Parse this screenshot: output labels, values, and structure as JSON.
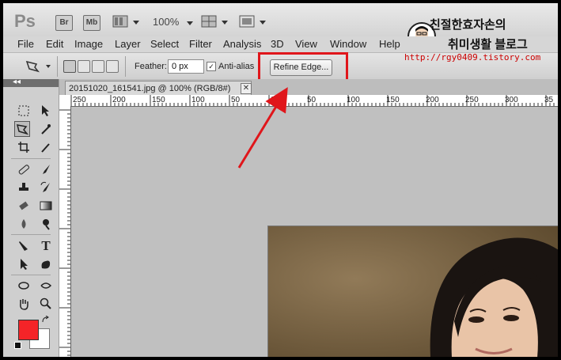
{
  "appbar": {
    "app_logo": "Ps",
    "bridge_label": "Br",
    "minibridge_label": "Mb",
    "zoom": "100%"
  },
  "menu": {
    "items": [
      "File",
      "Edit",
      "Image",
      "Layer",
      "Select",
      "Filter",
      "Analysis",
      "3D",
      "View",
      "Window",
      "Help"
    ]
  },
  "options": {
    "feather_label": "Feather:",
    "feather_value": "0 px",
    "antialias_label": "Anti-alias",
    "antialias_checked": "✓",
    "refine_edge_label": "Refine Edge..."
  },
  "toolbar": {
    "collapse_label": "◂◂",
    "foreground_color": "#f42428",
    "background_color": "#ffffff"
  },
  "document": {
    "tab_title": "20151020_161541.jpg @ 100% (RGB/8#)",
    "close_symbol": "✕"
  },
  "ruler": {
    "top_labels": [
      "250",
      "200",
      "150",
      "100",
      "50",
      "0",
      "50",
      "100",
      "150",
      "200",
      "250",
      "300",
      "35"
    ]
  },
  "blog": {
    "name_line1": "친절한효자손의",
    "name_line2": "취미생활 블로그",
    "url": "http://rgy0409.tistory.com"
  },
  "colors": {
    "highlight": "#e0161b",
    "arrow": "#e0161b"
  }
}
